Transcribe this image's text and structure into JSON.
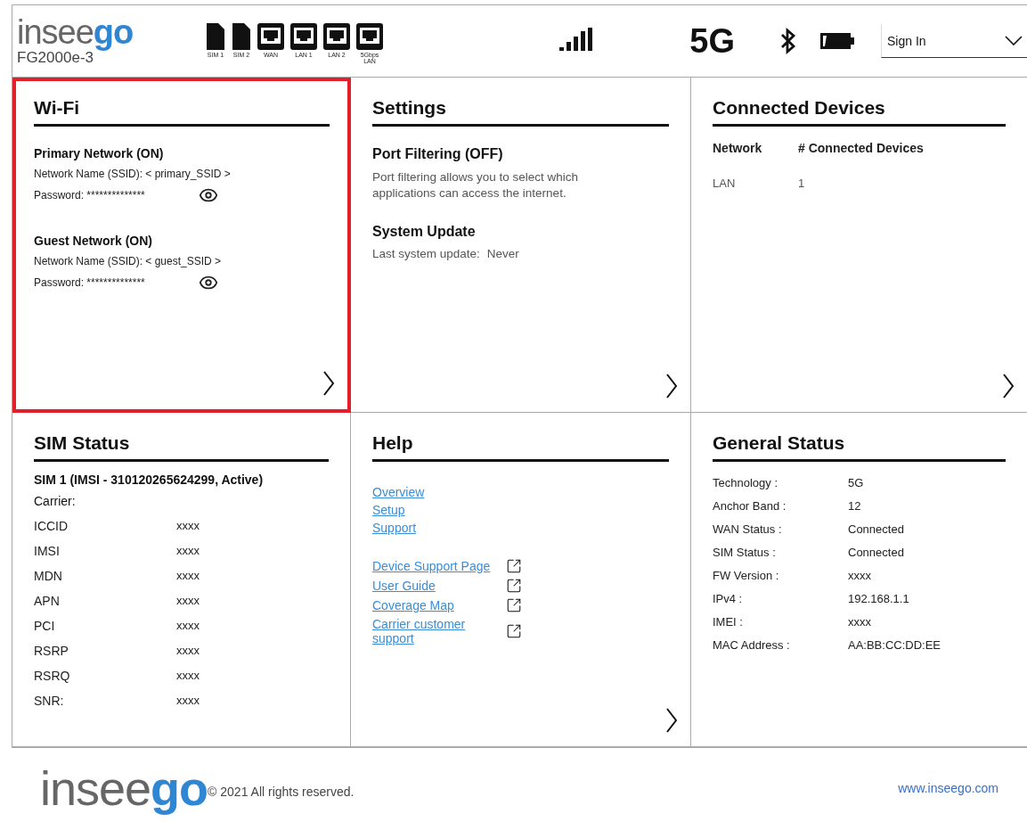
{
  "header": {
    "logo": {
      "light": "insee",
      "accent": "go"
    },
    "model": "FG2000e-3",
    "ports": [
      {
        "kind": "sim",
        "label": "SIM 1"
      },
      {
        "kind": "sim",
        "label": "SIM 2"
      },
      {
        "kind": "ethernet",
        "label": "WAN"
      },
      {
        "kind": "ethernet",
        "label": "LAN 1"
      },
      {
        "kind": "ethernet",
        "label": "LAN 2"
      },
      {
        "kind": "ethernet",
        "label": "5Gbps LAN"
      }
    ],
    "network_type": "5G",
    "account_select": {
      "value": "Sign In"
    }
  },
  "cards": [
    {
      "kind": "wifi",
      "title": "Wi-Fi",
      "highlighted": true,
      "arrow": true,
      "networks": [
        {
          "title": "Primary Network (ON)",
          "ssid": "Network Name (SSID): < primary_SSID >",
          "password": "Password: **************"
        },
        {
          "title": "Guest Network (ON)",
          "ssid": "Network Name (SSID): < guest_SSID >",
          "password": "Password: **************"
        }
      ]
    },
    {
      "kind": "settings",
      "title": "Settings",
      "highlighted": false,
      "arrow": true,
      "sections": [
        {
          "title": "Port Filtering (OFF)",
          "text": "Port filtering allows you to select which applications can access the internet."
        },
        {
          "title": "System Update",
          "label": "Last system update:",
          "value": "Never"
        }
      ]
    },
    {
      "kind": "devices",
      "title": "Connected Devices",
      "highlighted": false,
      "arrow": true,
      "columns": [
        "Network",
        "# Connected Devices"
      ],
      "rows": [
        [
          "LAN",
          "1"
        ]
      ]
    },
    {
      "kind": "sim",
      "title": "SIM Status",
      "highlighted": false,
      "arrow": false,
      "subtitle": "SIM 1 (IMSI - 310120265624299, Active)",
      "carrier": "Carrier:",
      "rows": [
        [
          "ICCID",
          "xxxx"
        ],
        [
          "IMSI",
          "xxxx"
        ],
        [
          "MDN",
          "xxxx"
        ],
        [
          "APN",
          "xxxx"
        ],
        [
          "PCI",
          "xxxx"
        ],
        [
          "RSRP",
          "xxxx"
        ],
        [
          "RSRQ",
          "xxxx"
        ],
        [
          "SNR:",
          "xxxx"
        ]
      ]
    },
    {
      "kind": "help",
      "title": "Help",
      "highlighted": false,
      "arrow": true,
      "link_groups": [
        [
          {
            "label": "Overview",
            "external": false
          },
          {
            "label": "Setup",
            "external": false
          },
          {
            "label": "Support",
            "external": false
          }
        ],
        [
          {
            "label": "Device Support Page",
            "external": true
          },
          {
            "label": "User Guide",
            "external": true
          },
          {
            "label": "Coverage Map",
            "external": true
          },
          {
            "label": "Carrier customer support",
            "external": true
          }
        ]
      ]
    },
    {
      "kind": "general",
      "title": "General Status",
      "highlighted": false,
      "arrow": false,
      "rows": [
        [
          "Technology :",
          "5G"
        ],
        [
          "Anchor Band :",
          "12"
        ],
        [
          "WAN Status :",
          "Connected"
        ],
        [
          "SIM Status :",
          "Connected"
        ],
        [
          "FW Version :",
          "xxxx"
        ],
        [
          "IPv4 :",
          "192.168.1.1"
        ],
        [
          "IMEI :",
          "xxxx"
        ],
        [
          "MAC Address :",
          "AA:BB:CC:DD:EE"
        ]
      ]
    }
  ],
  "footer": {
    "logo": {
      "light": "insee",
      "accent": "go"
    },
    "copyright": "© 2021 All rights reserved.",
    "link": "www.inseego.com"
  }
}
